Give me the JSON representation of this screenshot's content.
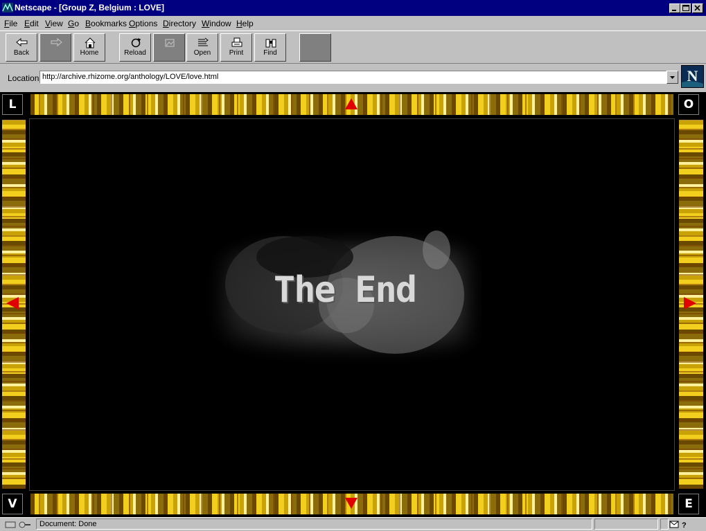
{
  "window": {
    "title": "Netscape - [Group Z, Belgium : LOVE]"
  },
  "menu": [
    {
      "label": "File",
      "u": "F",
      "rest": "ile"
    },
    {
      "label": "Edit",
      "u": "E",
      "rest": "dit"
    },
    {
      "label": "View",
      "u": "V",
      "rest": "iew"
    },
    {
      "label": "Go",
      "u": "G",
      "rest": "o"
    },
    {
      "label": "Bookmarks",
      "u": "B",
      "rest": "ookmarks"
    },
    {
      "label": "Options",
      "u": "O",
      "rest": "ptions"
    },
    {
      "label": "Directory",
      "u": "D",
      "rest": "irectory"
    },
    {
      "label": "Window",
      "u": "W",
      "rest": "indow"
    },
    {
      "label": "Help",
      "u": "H",
      "rest": "elp"
    }
  ],
  "toolbar": {
    "back": "Back",
    "home": "Home",
    "reload": "Reload",
    "open": "Open",
    "print": "Print",
    "find": "Find"
  },
  "location": {
    "label": "Location:",
    "url": "http://archive.rhizome.org/anthology/LOVE/love.html"
  },
  "frame": {
    "corner_tl": "L",
    "corner_tr": "O",
    "corner_bl": "V",
    "corner_br": "E",
    "accent": "#e00000"
  },
  "content": {
    "caption": "The End"
  },
  "status": {
    "text": "Document: Done"
  }
}
